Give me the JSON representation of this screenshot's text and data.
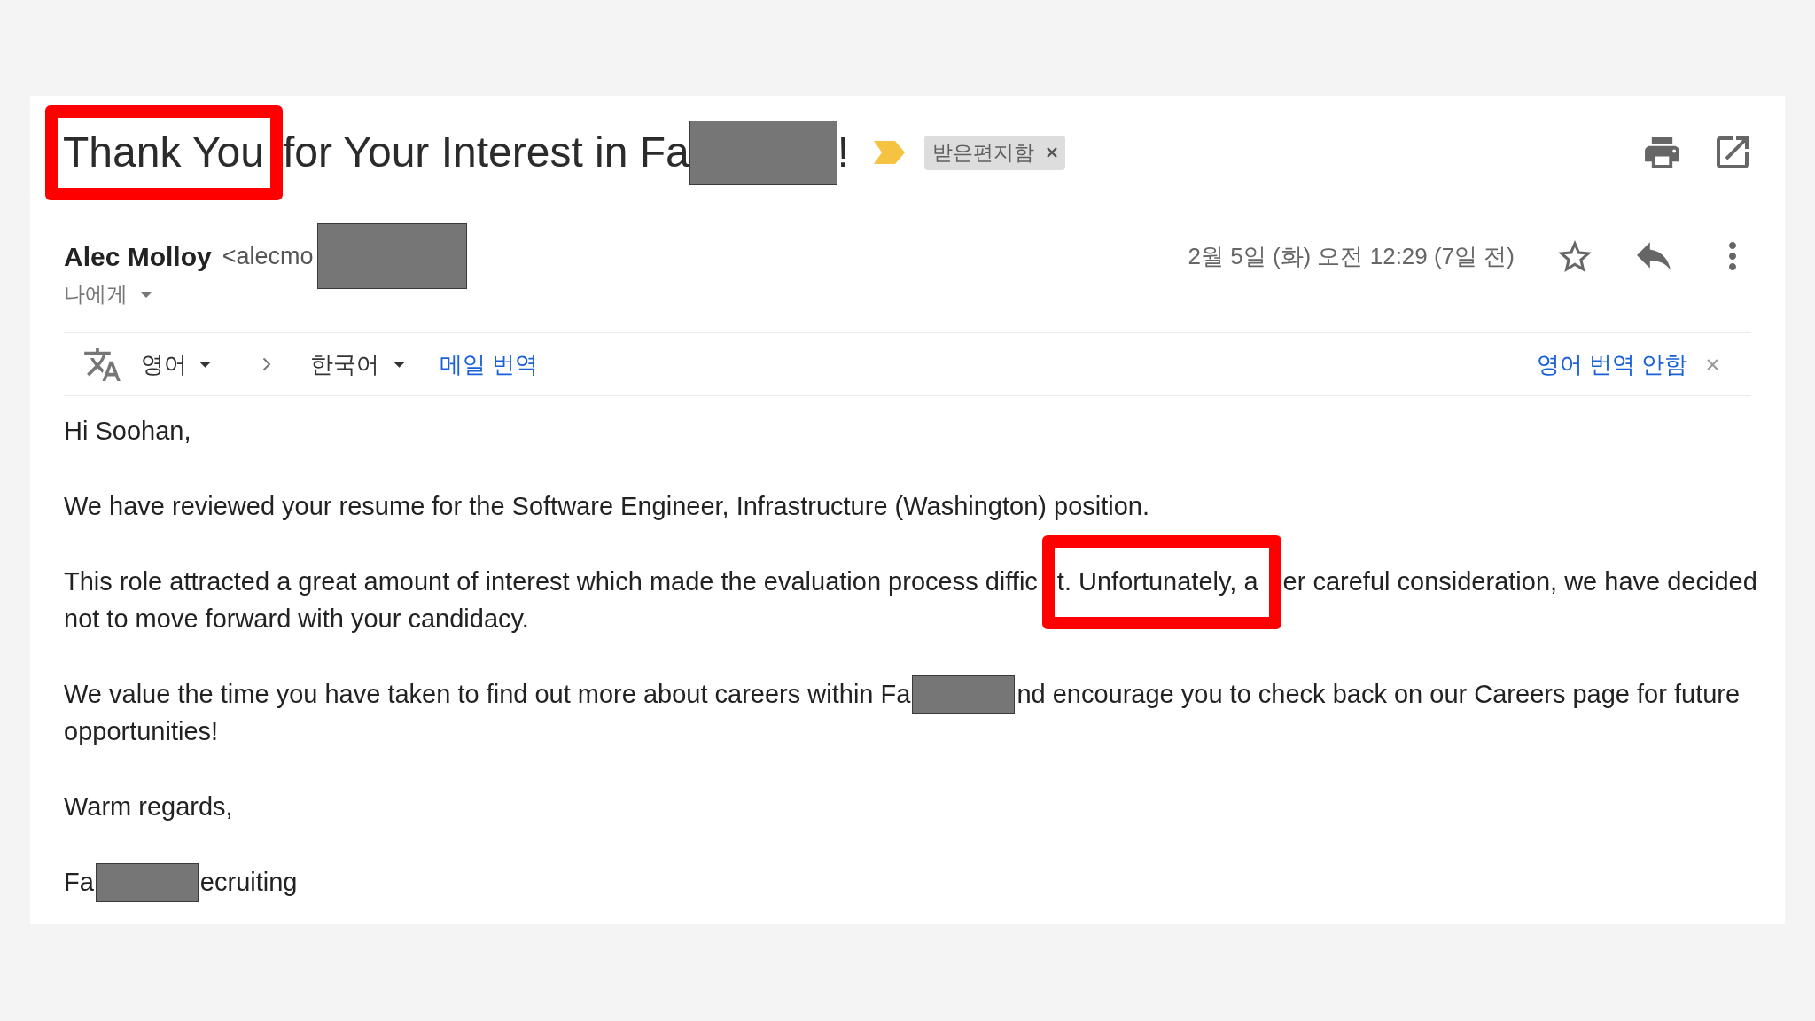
{
  "subject": {
    "segments": [
      {
        "kind": "highlighted",
        "text": "Thank You"
      },
      {
        "kind": "text",
        "text": "for Your Interest in Fa"
      },
      {
        "kind": "redacted"
      },
      {
        "kind": "text",
        "text": "!"
      }
    ],
    "important": true,
    "labels": [
      {
        "text": "받은편지함"
      }
    ]
  },
  "message": {
    "sender_name": "Alec Molloy",
    "sender_address": [
      {
        "kind": "text",
        "text": "<alecmo"
      },
      {
        "kind": "redacted"
      }
    ],
    "recipient": "나에게",
    "date": "2월 5일 (화) 오전 12:29 (7일 전)",
    "starred": false
  },
  "translation_bar": {
    "source_language": "영어",
    "target_language": "한국어",
    "translate_link": "메일 번역",
    "dismiss_link": "영어 번역 안함"
  },
  "body": {
    "paragraphs": [
      {
        "lines": [
          {
            "segments": [
              {
                "kind": "text",
                "text": "Hi Soohan,"
              }
            ]
          }
        ]
      },
      {
        "lines": [
          {
            "segments": [
              {
                "kind": "text",
                "text": "We have reviewed your resume for the Software Engineer, Infrastructure (Washington) position."
              }
            ]
          }
        ]
      },
      {
        "lines": [
          {
            "segments": [
              {
                "kind": "text",
                "text": "This role attracted a great amount of interest which made the evaluation process diffic"
              },
              {
                "kind": "highlighted",
                "text": "t. Unfortunately, a"
              },
              {
                "kind": "text",
                "text": "er careful consideration, we have decided"
              }
            ]
          },
          {
            "segments": [
              {
                "kind": "text",
                "text": "not to move forward with your candidacy."
              }
            ]
          }
        ]
      },
      {
        "lines": [
          {
            "segments": [
              {
                "kind": "text",
                "text": "We value the time you have taken to find out more about careers within Fa"
              },
              {
                "kind": "redacted"
              },
              {
                "kind": "text",
                "text": "nd encourage you to check back on our Careers page for future"
              }
            ]
          },
          {
            "segments": [
              {
                "kind": "text",
                "text": "opportunities!"
              }
            ]
          }
        ]
      },
      {
        "lines": [
          {
            "segments": [
              {
                "kind": "text",
                "text": "Warm regards,"
              }
            ]
          }
        ]
      },
      {
        "lines": [
          {
            "segments": [
              {
                "kind": "text",
                "text": "Fa"
              },
              {
                "kind": "redacted"
              },
              {
                "kind": "text",
                "text": "ecruiting"
              }
            ]
          }
        ]
      }
    ]
  }
}
